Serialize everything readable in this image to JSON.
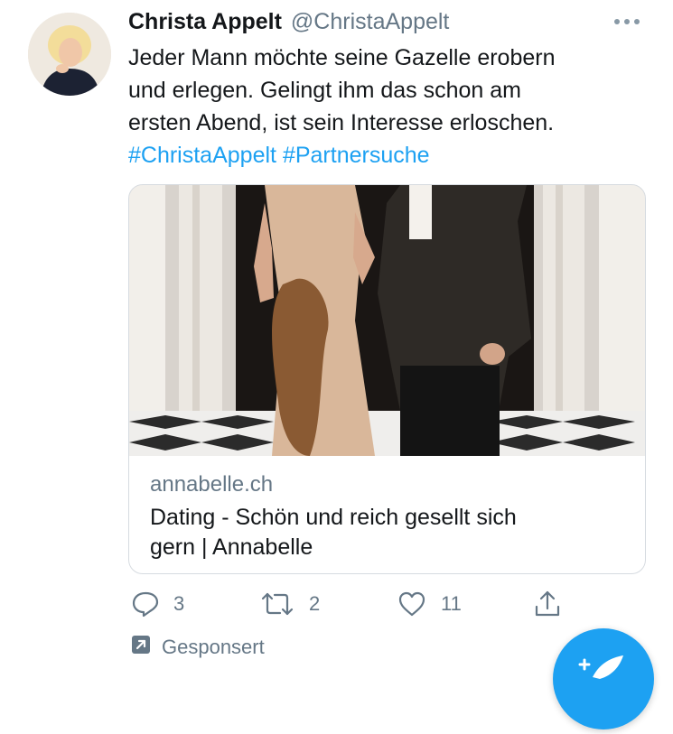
{
  "tweet": {
    "author_name": "Christa Appelt",
    "author_handle": "@ChristaAppelt",
    "text_lines": [
      "Jeder Mann möchte seine Gazelle erobern",
      "und erlegen. Gelingt ihm das schon am",
      "ersten Abend, ist sein Interesse erloschen."
    ],
    "hashtags": [
      "#ChristaAppelt",
      "#Partnersuche"
    ]
  },
  "card": {
    "domain": "annabelle.ch",
    "title_lines": [
      "Dating - Schön und reich gesellt sich",
      "gern | Annabelle"
    ]
  },
  "actions": {
    "reply_count": "3",
    "retweet_count": "2",
    "like_count": "11"
  },
  "promoted": {
    "label": "Gesponsert"
  },
  "icons": [
    "more-icon",
    "reply-icon",
    "retweet-icon",
    "like-icon",
    "share-icon",
    "promoted-arrow-icon",
    "compose-icon"
  ],
  "colors": {
    "link": "#1da1f2",
    "secondary": "#657786",
    "text": "#14171a"
  }
}
